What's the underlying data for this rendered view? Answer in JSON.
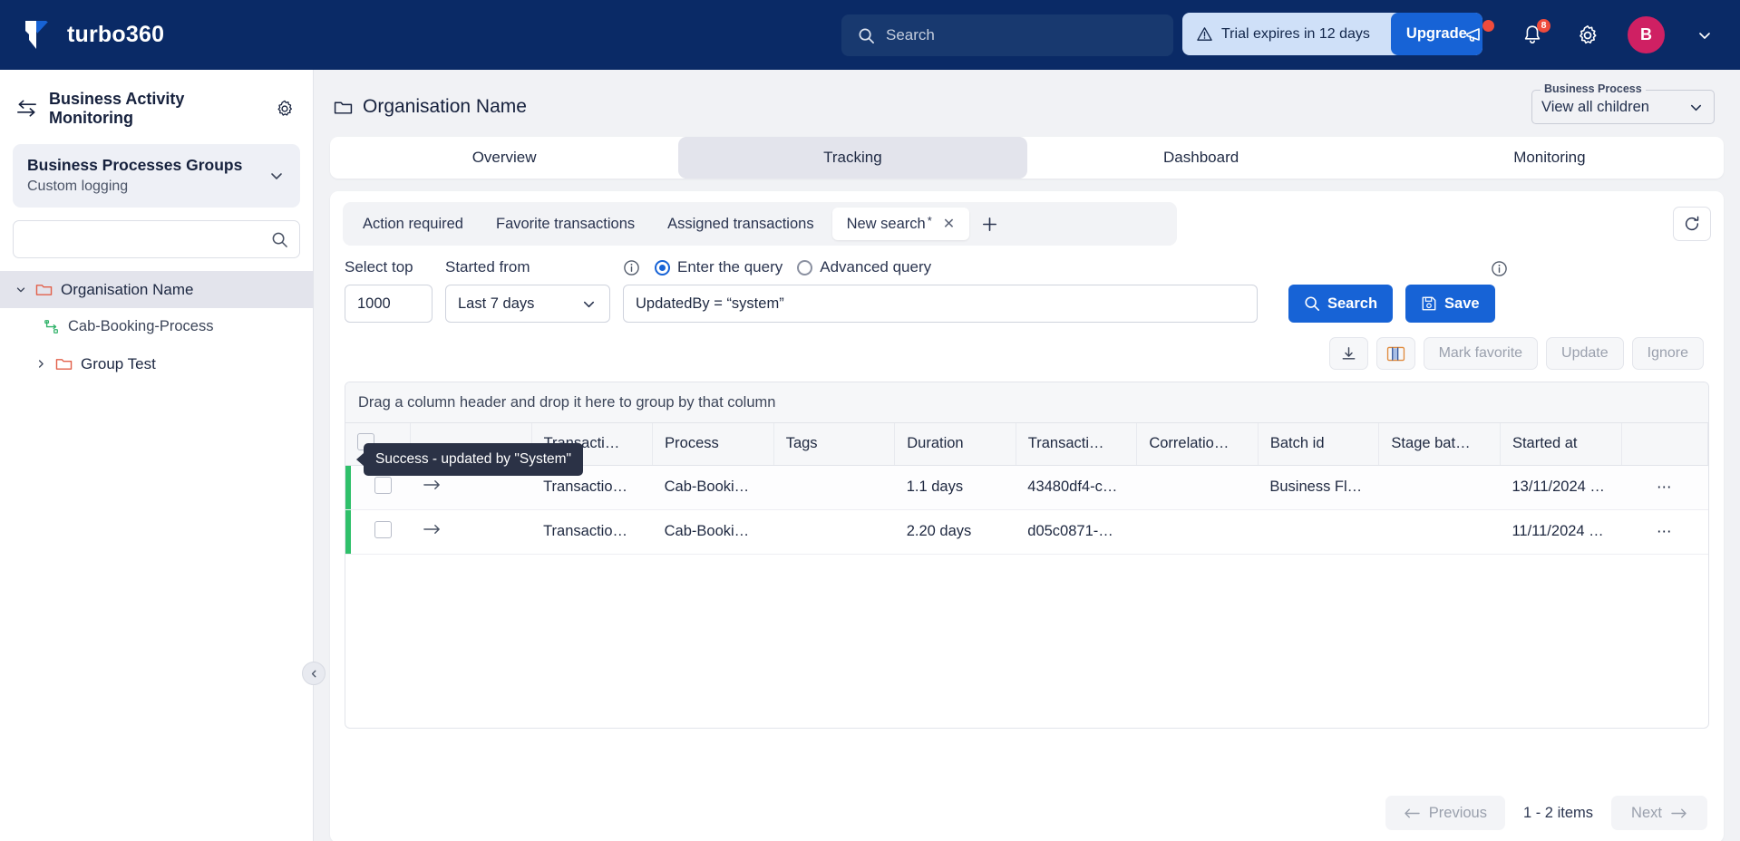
{
  "topbar": {
    "brand": "turbo360",
    "logo_icon": "turbo360-logo-icon",
    "search_placeholder": "Search",
    "search_value": "",
    "search_icon": "search-icon",
    "trial_text": "Trial expires in 12 days",
    "trial_warning_icon": "warning-triangle-icon",
    "upgrade_label": "Upgrade",
    "announcements_icon": "megaphone-icon",
    "notifications_icon": "bell-icon",
    "notifications_badge": "8",
    "settings_icon": "gear-icon",
    "avatar_initial": "B",
    "account_chevron_icon": "chevron-down-icon",
    "brand_bg": "#0a2a66",
    "avatar_bg": "#cf2063",
    "badge_bg": "#ef4b3c"
  },
  "sidebar": {
    "title": "Business Activity Monitoring",
    "title_icon": "bam-exchange-icon",
    "settings_icon": "gear-icon",
    "group_card": {
      "title": "Business Processes Groups",
      "subtitle": "Custom logging",
      "chevron_icon": "chevron-down-icon"
    },
    "search_placeholder": "",
    "search_value": "",
    "search_icon": "search-icon",
    "tree": [
      {
        "label": "Organisation Name",
        "icon": "folder-icon",
        "caret": "chevron-down-icon",
        "level": 1,
        "selected": true
      },
      {
        "label": "Cab-Booking-Process",
        "icon": "process-flow-icon",
        "caret": "",
        "level": 2,
        "selected": false
      },
      {
        "label": "Group Test",
        "icon": "folder-icon",
        "caret": "chevron-right-icon",
        "level": 2,
        "selected": false
      }
    ],
    "collapse_icon": "chevron-left-icon"
  },
  "page": {
    "title": "Organisation Name",
    "title_icon": "folder-icon",
    "business_process": {
      "label": "Business Process",
      "value": "View all children",
      "chevron_icon": "chevron-down-icon"
    },
    "tabs": [
      {
        "label": "Overview",
        "active": false
      },
      {
        "label": "Tracking",
        "active": true
      },
      {
        "label": "Dashboard",
        "active": false
      },
      {
        "label": "Monitoring",
        "active": false
      }
    ]
  },
  "search_tabs": {
    "items": [
      {
        "label": "Action required",
        "active": false,
        "dirty": false,
        "closable": false
      },
      {
        "label": "Favorite transactions",
        "active": false,
        "dirty": false,
        "closable": false
      },
      {
        "label": "Assigned transactions",
        "active": false,
        "dirty": false,
        "closable": false
      },
      {
        "label": "New search",
        "active": true,
        "dirty": true,
        "closable": true
      }
    ],
    "dirty_marker": "*",
    "close_icon": "close-icon",
    "add_label": "+",
    "add_icon": "plus-icon",
    "refresh_icon": "refresh-icon"
  },
  "query": {
    "select_top_label": "Select top",
    "select_top_value": "1000",
    "started_from_label": "Started from",
    "started_from_value": "Last 7 days",
    "started_from_chevron": "chevron-down-icon",
    "mode_info_icon": "info-icon",
    "query_info_icon": "info-icon",
    "modes": [
      {
        "label": "Enter the query",
        "selected": true
      },
      {
        "label": "Advanced query",
        "selected": false
      }
    ],
    "query_value": "UpdatedBy = “system”",
    "query_placeholder": "",
    "search_button": "Search",
    "search_icon": "search-icon",
    "save_button": "Save",
    "save_icon": "floppy-disk-icon"
  },
  "toolbar": {
    "download_icon": "download-icon",
    "columns_icon": "column-chooser-icon",
    "mark_favorite_label": "Mark favorite",
    "update_label": "Update",
    "ignore_label": "Ignore"
  },
  "grid": {
    "group_hint": "Drag a column header and drop it here to group by that column",
    "columns": [
      "",
      "",
      "Transacti…",
      "Process",
      "Tags",
      "Duration",
      "Transacti…",
      "Correlatio…",
      "Batch id",
      "Stage bat…",
      "Started at",
      ""
    ],
    "expand_icon": "arrow-right-icon",
    "row_menu_icon": "ellipsis-icon",
    "status_color": "#2fc06a",
    "rows": [
      {
        "status": "success",
        "transaction_name": "Transactio…",
        "process": "Cab-Booki…",
        "tags": "",
        "duration": "1.1 days",
        "transaction_id": "43480df4-c…",
        "correlation_id": "",
        "batch_id": "Business Fl…",
        "stage_batch": "",
        "started_at": "13/11/2024 …"
      },
      {
        "status": "success",
        "transaction_name": "Transactio…",
        "process": "Cab-Booki…",
        "tags": "",
        "duration": "2.20 days",
        "transaction_id": "d05c0871-…",
        "correlation_id": "",
        "batch_id": "",
        "stage_batch": "",
        "started_at": "11/11/2024 …"
      }
    ],
    "tooltip": "Success - updated by \"System\""
  },
  "pager": {
    "previous_label": "Previous",
    "previous_icon": "arrow-left-icon",
    "count_label": "1 - 2 items",
    "next_label": "Next",
    "next_icon": "arrow-right-icon"
  }
}
